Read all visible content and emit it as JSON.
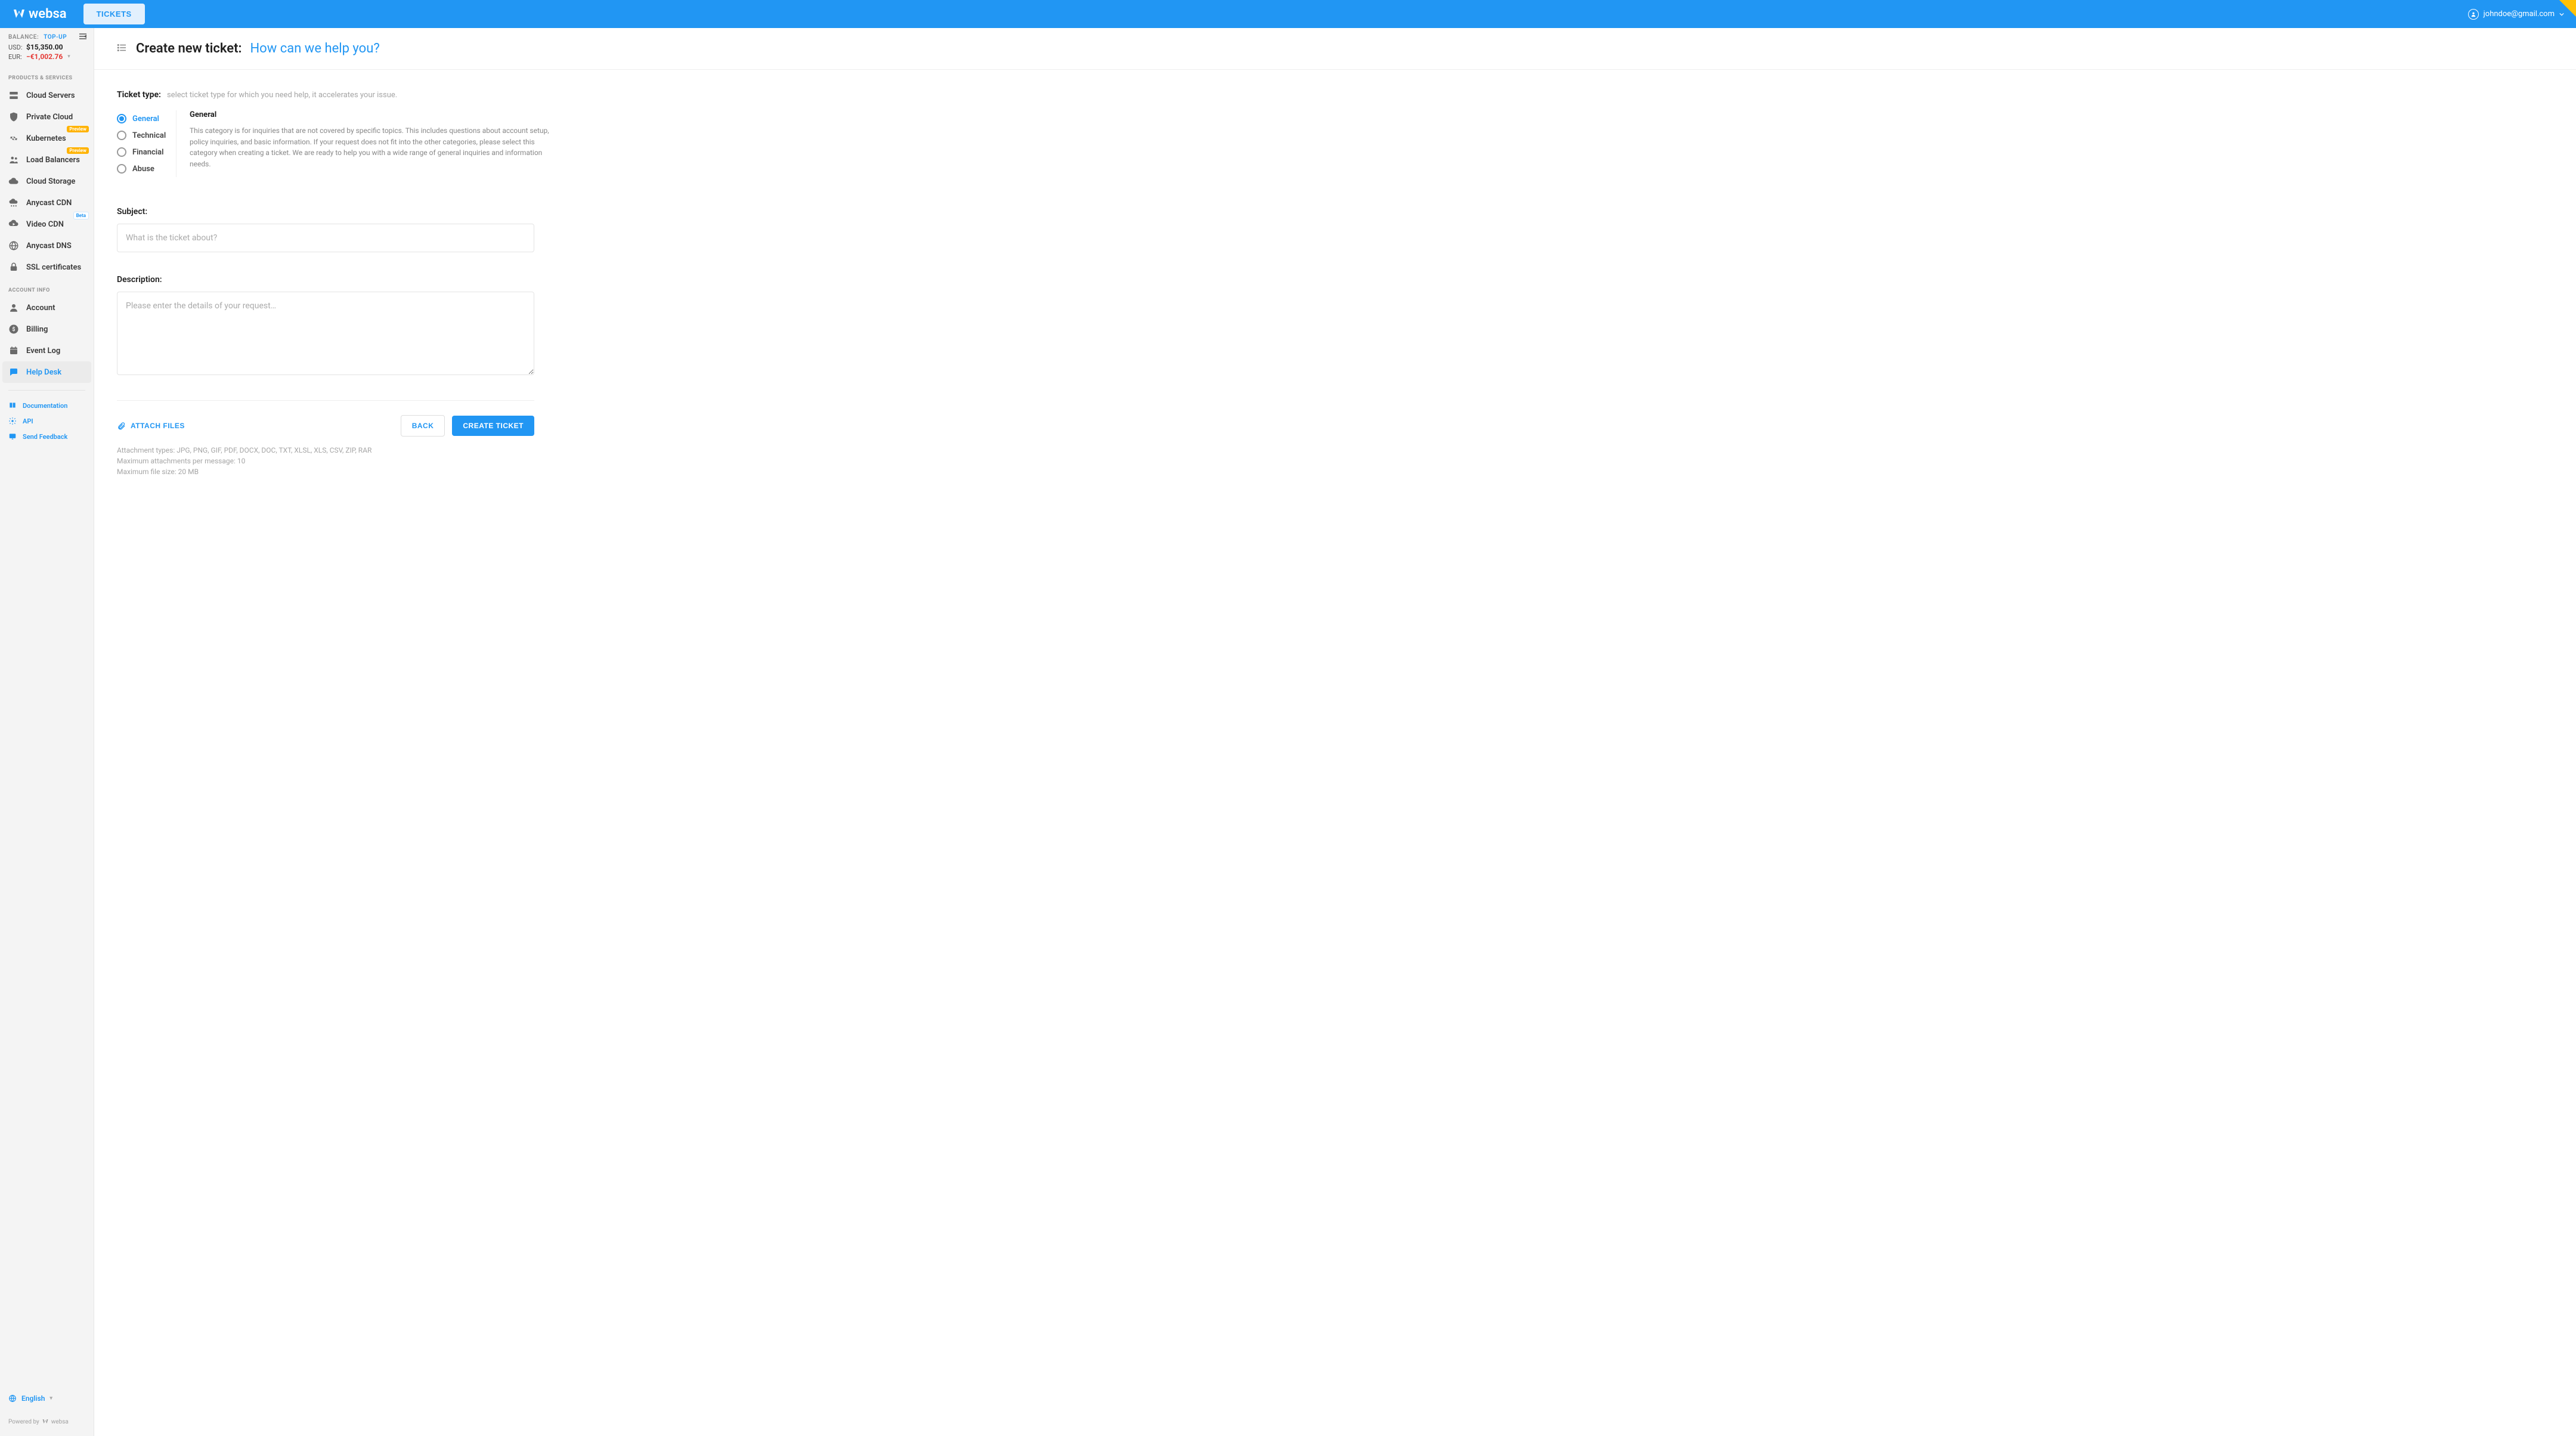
{
  "brand": "websa",
  "tab": "TICKETS",
  "user_email": "johndoe@gmail.com",
  "balance": {
    "label": "BALANCE:",
    "topup": "TOP-UP",
    "usd_label": "USD:",
    "usd_amount": "$15,350.00",
    "eur_label": "EUR:",
    "eur_amount": "−€1,002.76"
  },
  "sidebar": {
    "products_heading": "PRODUCTS & SERVICES",
    "account_heading": "ACCOUNT INFO",
    "items": {
      "cloud_servers": "Cloud Servers",
      "private_cloud": "Private Cloud",
      "kubernetes": "Kubernetes",
      "load_balancers": "Load Balancers",
      "cloud_storage": "Cloud Storage",
      "anycast_cdn": "Anycast CDN",
      "video_cdn": "Video CDN",
      "anycast_dns": "Anycast DNS",
      "ssl": "SSL certificates",
      "account": "Account",
      "billing": "Billing",
      "event_log": "Event Log",
      "help_desk": "Help Desk"
    },
    "badge_preview": "Preview",
    "badge_beta": "Beta",
    "links": {
      "documentation": "Documentation",
      "api": "API",
      "feedback": "Send Feedback"
    },
    "language": "English",
    "powered": "Powered by",
    "powered_brand": "websa"
  },
  "page": {
    "title": "Create new ticket:",
    "subtitle": "How can we help you?",
    "ticket_type_label": "Ticket type:",
    "ticket_type_hint": "select ticket type for which you need help, it accelerates your issue.",
    "types": {
      "general": "General",
      "technical": "Technical",
      "financial": "Financial",
      "abuse": "Abuse"
    },
    "type_desc_title": "General",
    "type_desc_body": "This category is for inquiries that are not covered by specific topics. This includes questions about account setup, policy inquiries, and basic information. If your request does not fit into the other categories, please select this category when creating a ticket. We are ready to help you with a wide range of general inquiries and information needs.",
    "subject_label": "Subject:",
    "subject_placeholder": "What is the ticket about?",
    "description_label": "Description:",
    "description_placeholder": "Please enter the details of your request…",
    "attach_files": "ATTACH FILES",
    "back": "BACK",
    "create": "CREATE TICKET",
    "attach_info_1": "Attachment types: JPG, PNG, GIF, PDF, DOCX, DOC, TXT, XLSL, XLS, CSV, ZIP, RAR",
    "attach_info_2": "Maximum attachments per message: 10",
    "attach_info_3": "Maximum file size: 20 MB"
  }
}
